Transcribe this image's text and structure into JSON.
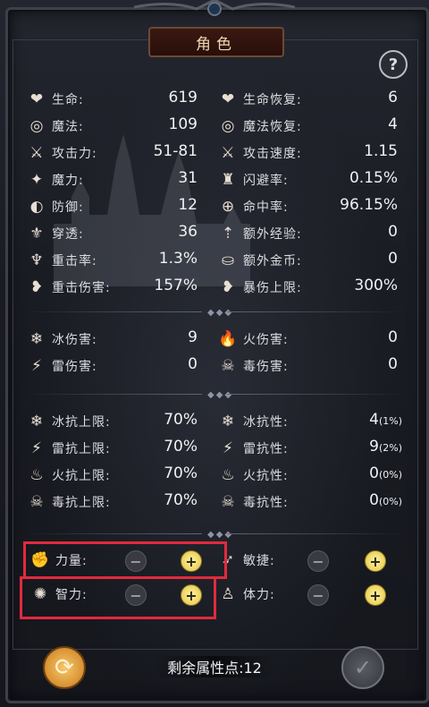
{
  "title": "角色",
  "help_icon_text": "?",
  "stats_basic": [
    {
      "icon": "heart-icon",
      "glyph": "❤",
      "label": "生命:",
      "value": "619"
    },
    {
      "icon": "heart-plus-icon",
      "glyph": "❤",
      "label": "生命恢复:",
      "value": "6"
    },
    {
      "icon": "swirl-icon",
      "glyph": "◎",
      "label": "魔法:",
      "value": "109"
    },
    {
      "icon": "swirl-plus-icon",
      "glyph": "◎",
      "label": "魔法恢复:",
      "value": "4"
    },
    {
      "icon": "sword-icon",
      "glyph": "⚔",
      "label": "攻击力:",
      "value": "51-81"
    },
    {
      "icon": "sword-speed-icon",
      "glyph": "⚔",
      "label": "攻击速度:",
      "value": "1.15"
    },
    {
      "icon": "wand-icon",
      "glyph": "✦",
      "label": "魔力:",
      "value": "31"
    },
    {
      "icon": "dodge-icon",
      "glyph": "♜",
      "label": "闪避率:",
      "value": "0.15%"
    },
    {
      "icon": "shield-icon",
      "glyph": "◐",
      "label": "防御:",
      "value": "12"
    },
    {
      "icon": "crosshair-icon",
      "glyph": "⊕",
      "label": "命中率:",
      "value": "96.15%"
    },
    {
      "icon": "pierce-icon",
      "glyph": "⚜",
      "label": "穿透:",
      "value": "36"
    },
    {
      "icon": "exp-icon",
      "glyph": "⇡",
      "label": "额外经验:",
      "value": "0"
    },
    {
      "icon": "crit-icon",
      "glyph": "♆",
      "label": "重击率:",
      "value": "1.3%"
    },
    {
      "icon": "gold-icon",
      "glyph": "⛀",
      "label": "额外金币:",
      "value": "0"
    },
    {
      "icon": "crit-damage-icon",
      "glyph": "❥",
      "label": "重击伤害:",
      "value": "157%"
    },
    {
      "icon": "crit-cap-icon",
      "glyph": "❥",
      "label": "暴伤上限:",
      "value": "300%"
    }
  ],
  "elemental_damage": [
    {
      "icon": "ice-icon",
      "glyph": "❄",
      "label": "冰伤害:",
      "value": "9"
    },
    {
      "icon": "fire-icon",
      "glyph": "🔥",
      "label": "火伤害:",
      "value": "0"
    },
    {
      "icon": "lightning-icon",
      "glyph": "⚡",
      "label": "雷伤害:",
      "value": "0"
    },
    {
      "icon": "poison-icon",
      "glyph": "☠",
      "label": "毒伤害:",
      "value": "0"
    }
  ],
  "resistances": [
    {
      "icon": "ice-cap-icon",
      "glyph": "❄",
      "label": "冰抗上限:",
      "value": "70%",
      "sub": ""
    },
    {
      "icon": "ice-res-icon",
      "glyph": "❄",
      "label": "冰抗性:",
      "value": "4",
      "sub": "(1%)"
    },
    {
      "icon": "lightning-cap-icon",
      "glyph": "⚡",
      "label": "雷抗上限:",
      "value": "70%",
      "sub": ""
    },
    {
      "icon": "lightning-res-icon",
      "glyph": "⚡",
      "label": "雷抗性:",
      "value": "9",
      "sub": "(2%)"
    },
    {
      "icon": "fire-cap-icon",
      "glyph": "♨",
      "label": "火抗上限:",
      "value": "70%",
      "sub": ""
    },
    {
      "icon": "fire-res-icon",
      "glyph": "♨",
      "label": "火抗性:",
      "value": "0",
      "sub": "(0%)"
    },
    {
      "icon": "poison-cap-icon",
      "glyph": "☠",
      "label": "毒抗上限:",
      "value": "70%",
      "sub": ""
    },
    {
      "icon": "poison-res-icon",
      "glyph": "☠",
      "label": "毒抗性:",
      "value": "0",
      "sub": "(0%)"
    }
  ],
  "attributes": [
    {
      "icon": "strength-icon",
      "glyph": "✊",
      "label": "力量:"
    },
    {
      "icon": "agility-icon",
      "glyph": "➶",
      "label": "敏捷:"
    },
    {
      "icon": "intellect-icon",
      "glyph": "✺",
      "label": "智力:"
    },
    {
      "icon": "vitality-icon",
      "glyph": "♙",
      "label": "体力:"
    }
  ],
  "remaining_points": "剩余属性点:12",
  "buttons": {
    "minus": "−",
    "plus": "+",
    "reset": "⟳",
    "confirm": "✓"
  },
  "colors": {
    "highlight": "#e22a3e",
    "plus_button": "#e3c23c",
    "banner": "#2a0e0a",
    "reset_button": "#d18a2a"
  }
}
